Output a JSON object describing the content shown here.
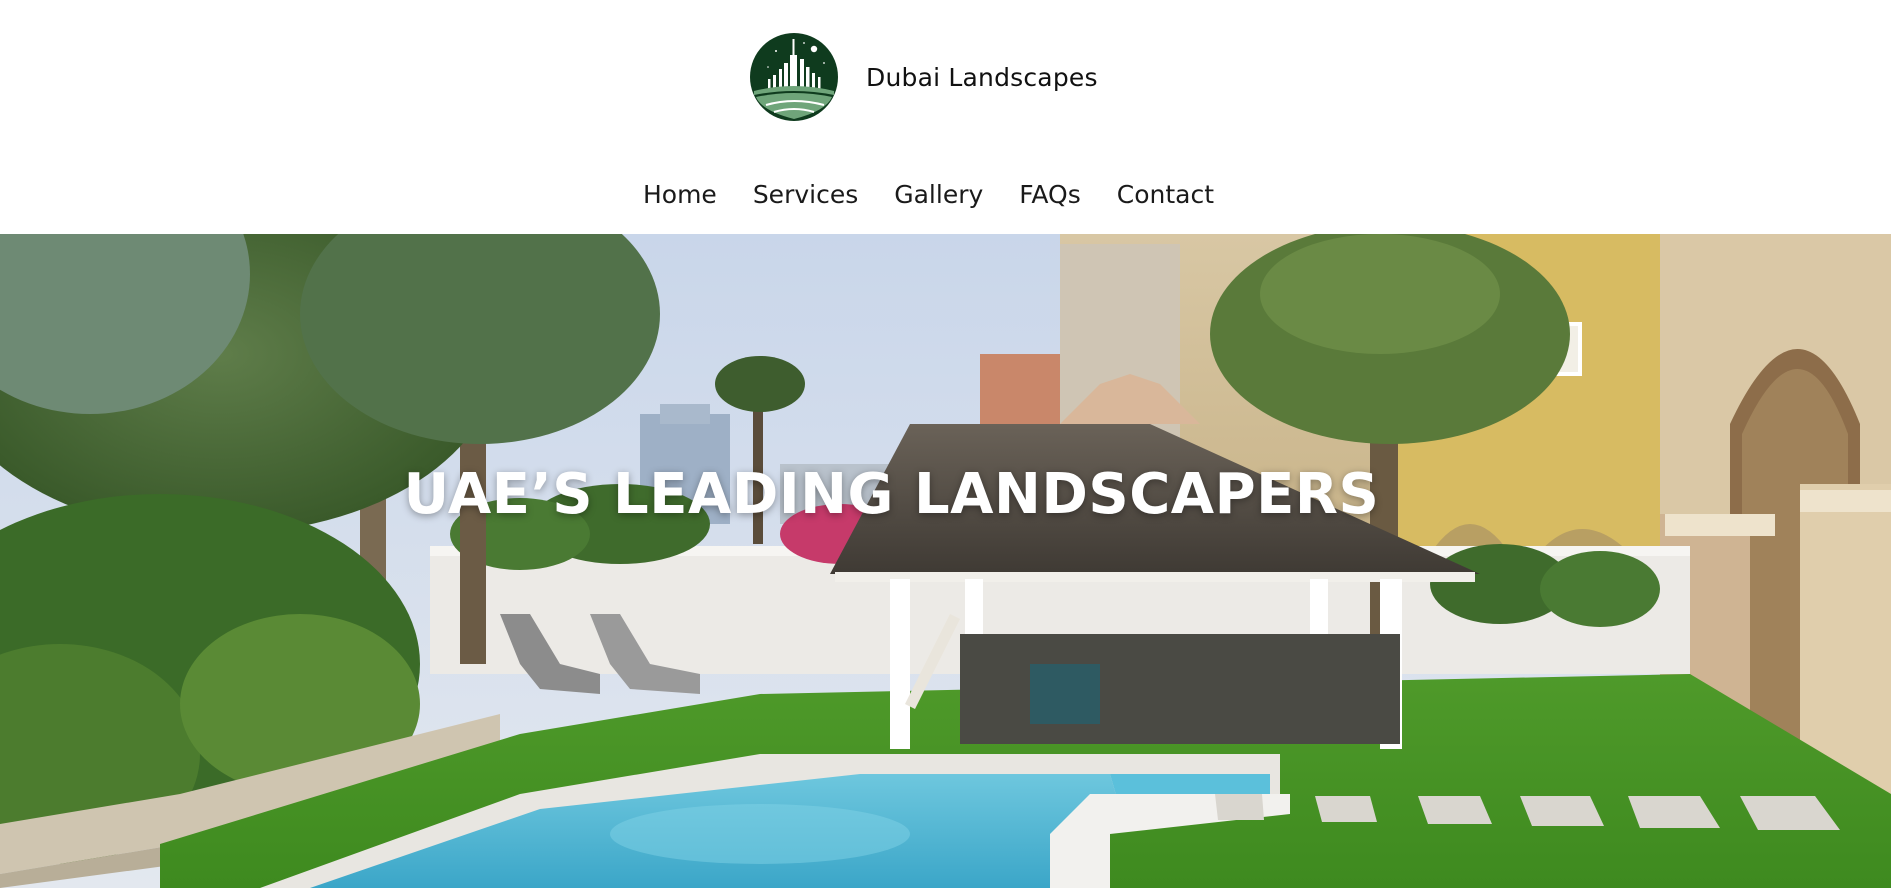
{
  "site": {
    "brand_name": "Dubai Landscapes",
    "logo_icon": "city-skyline-logo-icon"
  },
  "nav": {
    "items": [
      {
        "label": "Home"
      },
      {
        "label": "Services"
      },
      {
        "label": "Gallery"
      },
      {
        "label": "FAQs"
      },
      {
        "label": "Contact"
      }
    ]
  },
  "hero": {
    "title": "UAE’S LEADING LANDSCAPERS",
    "image": "garden-pool-palm-trees-photo"
  },
  "colors": {
    "logo_green": "#0f3b1e",
    "logo_light_green": "#6fa57a",
    "title_text": "#ffffff",
    "nav_text": "#1a1a1a"
  }
}
